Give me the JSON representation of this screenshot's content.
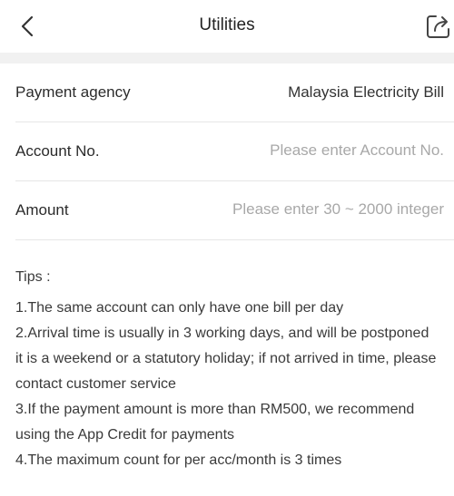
{
  "header": {
    "title": "Utilities",
    "back_icon": "chevron-left-icon",
    "share_icon": "share-icon"
  },
  "form": {
    "payment_agency": {
      "label": "Payment agency",
      "value": "Malaysia Electricity Bill"
    },
    "account_no": {
      "label": "Account No.",
      "placeholder": "Please enter Account No.",
      "value": ""
    },
    "amount": {
      "label": "Amount",
      "placeholder": "Please enter 30 ~ 2000 integer",
      "value": ""
    }
  },
  "tips": {
    "title": "Tips :",
    "lines": [
      "1.The same account can only have one bill per day",
      "2.Arrival time is usually in 3 working days, and will be postponed",
      "it is a weekend or a statutory holiday; if not arrived in time, please",
      "contact customer service",
      "3.If the payment amount is more than RM500, we recommend",
      "using the App Credit for payments",
      "4.The maximum count for per acc/month is 3 times"
    ]
  },
  "colors": {
    "background": "#ffffff",
    "separator_band": "#f1f1f1",
    "divider": "#e6e6e6",
    "placeholder": "#a8a8a8",
    "text": "#2b2b2b"
  }
}
